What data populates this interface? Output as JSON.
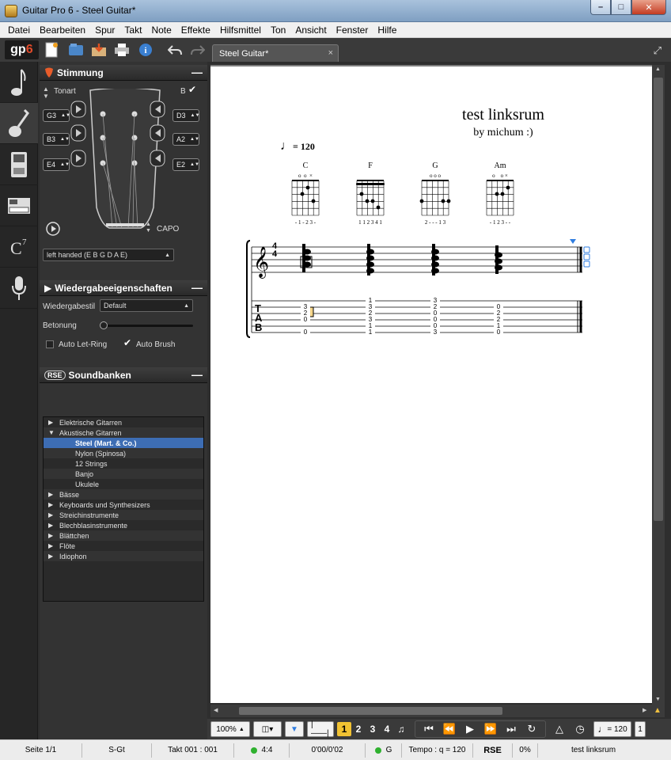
{
  "window": {
    "title": "Guitar Pro 6 - Steel Guitar*"
  },
  "menu": [
    "Datei",
    "Bearbeiten",
    "Spur",
    "Takt",
    "Note",
    "Effekte",
    "Hilfsmittel",
    "Ton",
    "Ansicht",
    "Fenster",
    "Hilfe"
  ],
  "toolbar": {
    "logo": "gp6"
  },
  "tuning": {
    "header": "Stimmung",
    "tonart_label": "Tonart",
    "b_label": "B",
    "left_pegs": [
      "G3",
      "B3",
      "E4"
    ],
    "right_pegs": [
      "D3",
      "A2",
      "E2"
    ],
    "capo_label": "CAPO",
    "preset": "left handed (E B G D A E)"
  },
  "playback": {
    "header": "Wiedergabeeigenschaften",
    "style_label": "Wiedergabestil",
    "style_value": "Default",
    "accent_label": "Betonung",
    "let_ring": "Auto Let-Ring",
    "auto_brush": "Auto Brush"
  },
  "soundbanks": {
    "header": "Soundbanken",
    "logo": "RSE",
    "items": [
      {
        "label": "Elektrische Gitarren",
        "level": 0,
        "tri": "▶"
      },
      {
        "label": "Akustische Gitarren",
        "level": 0,
        "tri": "▼"
      },
      {
        "label": "Steel (Mart. & Co.)",
        "level": 1,
        "selected": true
      },
      {
        "label": "Nylon (Spinosa)",
        "level": 1
      },
      {
        "label": "12 Strings",
        "level": 1
      },
      {
        "label": "Banjo",
        "level": 1
      },
      {
        "label": "Ukulele",
        "level": 1
      },
      {
        "label": "Bässe",
        "level": 0,
        "tri": "▶"
      },
      {
        "label": "Keyboards und Synthesizers",
        "level": 0,
        "tri": "▶"
      },
      {
        "label": "Streichinstrumente",
        "level": 0,
        "tri": "▶"
      },
      {
        "label": "Blechblasinstrumente",
        "level": 0,
        "tri": "▶"
      },
      {
        "label": "Blättchen",
        "level": 0,
        "tri": "▶"
      },
      {
        "label": "Flöte",
        "level": 0,
        "tri": "▶"
      },
      {
        "label": "Idiophon",
        "level": 0,
        "tri": "▶"
      }
    ]
  },
  "tab": {
    "label": "Steel Guitar*",
    "close": "×"
  },
  "score": {
    "title": "test linksrum",
    "subtitle": "by michum :)",
    "tempo": "= 120",
    "chords": [
      {
        "name": "C",
        "marks": "o  o  ×",
        "fingering": "- 1 - 2 3 -"
      },
      {
        "name": "F",
        "marks": "",
        "fingering": "1 1 2 3 4 1"
      },
      {
        "name": "G",
        "marks": "o o o",
        "fingering": "2 - - - 1 3"
      },
      {
        "name": "Am",
        "marks": "o    o ×",
        "fingering": "- 1 2 3 - -"
      }
    ],
    "time_sig": [
      "4",
      "4"
    ],
    "tab_letters": [
      "T",
      "A",
      "B"
    ],
    "tab_columns": [
      [
        "3",
        "2",
        "0",
        "",
        "0"
      ],
      [
        "1",
        "3",
        "2",
        "3",
        "1",
        "1"
      ],
      [
        "3",
        "2",
        "0",
        "0",
        "0",
        "3"
      ],
      [
        "0",
        "2",
        "2",
        "1",
        "0"
      ]
    ]
  },
  "controls": {
    "zoom": "100%",
    "voices": [
      "1",
      "2",
      "3",
      "4"
    ],
    "tempo": "= 120"
  },
  "status": {
    "page": "Seite 1/1",
    "track": "S-Gt",
    "bar": "Takt 001 : 001",
    "sig": "4:4",
    "time": "0'00/0'02",
    "key": "G",
    "tempo": "Tempo : q = 120",
    "rse": "RSE",
    "percent": "0%",
    "file": "test linksrum"
  }
}
